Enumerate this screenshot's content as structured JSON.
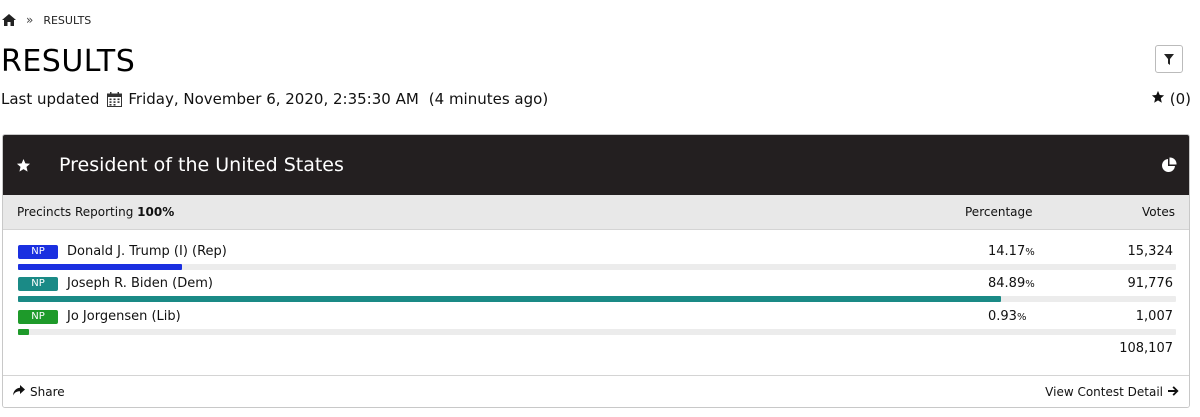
{
  "breadcrumb": {
    "home_icon": "home-icon",
    "separator": "»",
    "current": "RESULTS"
  },
  "page": {
    "title": "RESULTS",
    "filter_icon": "filter-icon"
  },
  "last_updated": {
    "label": "Last updated",
    "calendar_icon": "calendar-icon",
    "datetime": "Friday, November 6, 2020, 2:35:30 AM",
    "relative": "(4 minutes ago)"
  },
  "favorites": {
    "icon": "star-icon",
    "count": "(0)"
  },
  "contest": {
    "title": "President of the United States",
    "star_icon": "star-icon",
    "chart_icon": "pie-chart-icon",
    "precincts_label": "Precincts Reporting",
    "precincts_value": "100%",
    "col_percentage": "Percentage",
    "col_votes": "Votes",
    "candidates": [
      {
        "badge": "NP",
        "name": "Donald J. Trump (I) (Rep)",
        "pct": "14.17",
        "pct_value": 14.17,
        "votes": "15,324",
        "color": "#1a2fe0"
      },
      {
        "badge": "NP",
        "name": "Joseph R. Biden (Dem)",
        "pct": "84.89",
        "pct_value": 84.89,
        "votes": "91,776",
        "color": "#1a8a86"
      },
      {
        "badge": "NP",
        "name": "Jo Jorgensen (Lib)",
        "pct": "0.93",
        "pct_value": 0.93,
        "votes": "1,007",
        "color": "#1e9a2a"
      }
    ],
    "pct_sign": "%",
    "total_votes": "108,107",
    "share_label": "Share",
    "share_icon": "share-icon",
    "detail_label": "View Contest Detail",
    "detail_icon": "arrow-right-icon"
  }
}
